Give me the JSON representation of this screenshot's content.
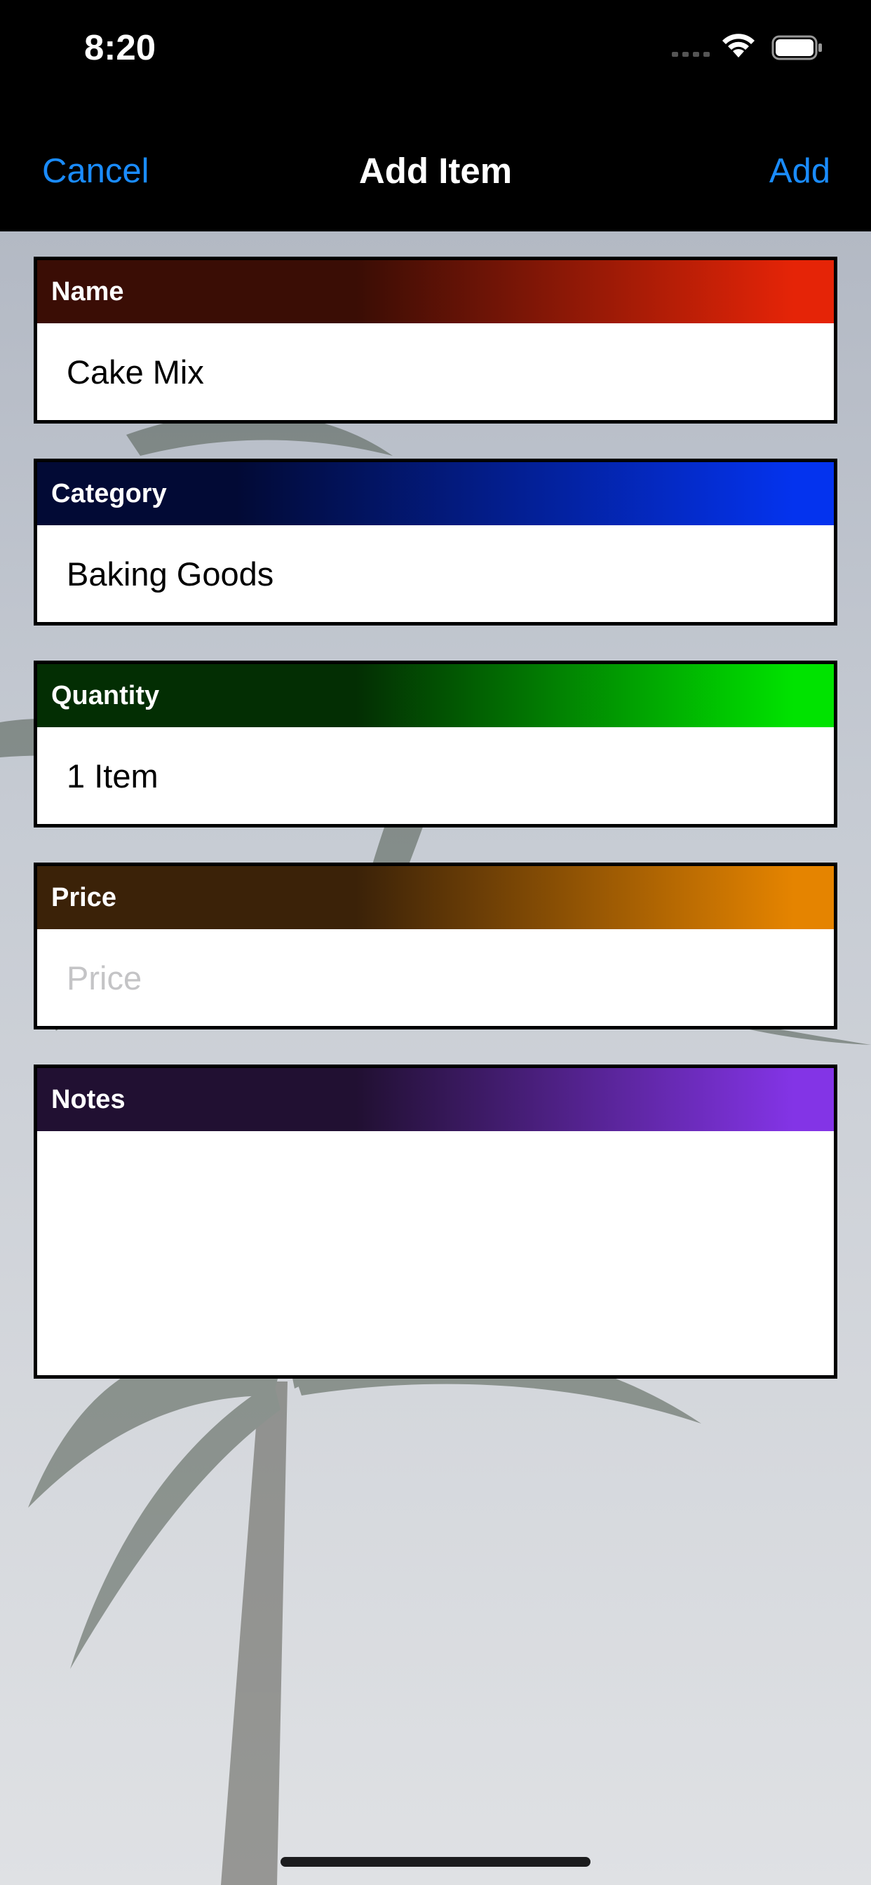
{
  "status_bar": {
    "time": "8:20"
  },
  "nav": {
    "cancel_label": "Cancel",
    "title": "Add Item",
    "add_label": "Add"
  },
  "fields": {
    "name": {
      "label": "Name",
      "value": "Cake Mix",
      "color": "#e52407"
    },
    "category": {
      "label": "Category",
      "value": "Baking Goods",
      "color": "#0433ee"
    },
    "quantity": {
      "label": "Quantity",
      "value": "1 Item",
      "color": "#00e300"
    },
    "price": {
      "label": "Price",
      "value": "",
      "placeholder": "Price",
      "color": "#e58400"
    },
    "notes": {
      "label": "Notes",
      "value": "",
      "color": "#8334e6"
    }
  },
  "icons": [
    "cellular-signal-icon",
    "wifi-icon",
    "battery-icon"
  ]
}
